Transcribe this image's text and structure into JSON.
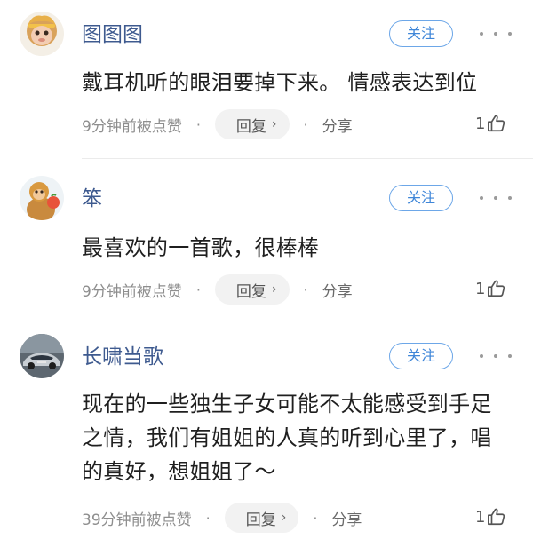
{
  "follow_label": "关注",
  "reply_label": "回复",
  "share_label": "分享",
  "comments": [
    {
      "username": "图图图",
      "content": "戴耳机听的眼泪要掉下来。 情感表达到位",
      "time": "9分钟前被点赞",
      "likes": "1"
    },
    {
      "username": "笨",
      "content": "最喜欢的一首歌，很棒棒",
      "time": "9分钟前被点赞",
      "likes": "1"
    },
    {
      "username": "长啸当歌",
      "content": "现在的一些独生子女可能不太能感受到手足之情，我们有姐姐的人真的听到心里了，唱的真好，想姐姐了～",
      "time": "39分钟前被点赞",
      "likes": "1"
    }
  ],
  "colors": {
    "username": "#3e5a8f",
    "follow_border": "#6da7e8",
    "follow_text": "#3f86d8",
    "meta_text": "#8e8e8e",
    "reply_bg": "#f2f2f2"
  },
  "icons": [
    "more-icon",
    "chevron-right-icon",
    "thumbs-up-icon"
  ]
}
